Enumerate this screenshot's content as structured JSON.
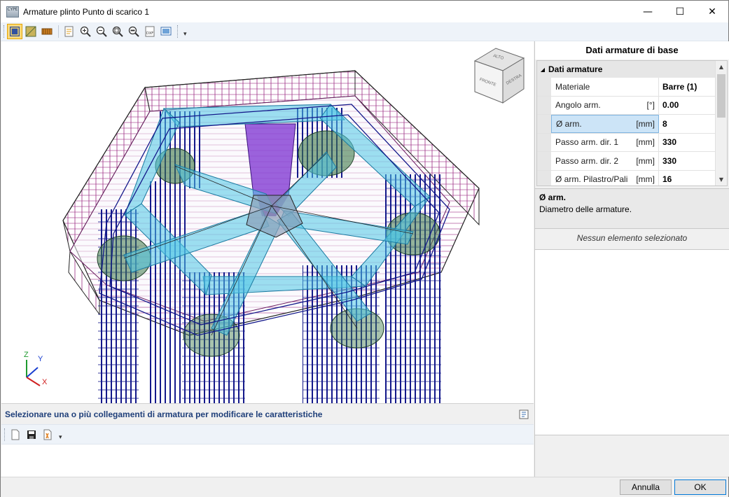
{
  "window": {
    "app_icon_text": "CYPE",
    "title": "Armature plinto Punto di scarico 1",
    "minimize": "—",
    "maximize": "☐",
    "close": "✕"
  },
  "viewport": {
    "viewcube": {
      "top": "ALTO",
      "front": "FRONTE",
      "right": "DESTRA"
    },
    "axes": {
      "x": "X",
      "y": "Y",
      "z": "Z"
    }
  },
  "hint": {
    "text": "Selezionare una o più collegamenti di armatura per modificare le caratteristiche"
  },
  "panel": {
    "title": "Dati armature di base",
    "category": "Dati armature",
    "rows": [
      {
        "name": "Materiale",
        "unit": "",
        "value": "Barre (1)",
        "dropdown": true
      },
      {
        "name": "Angolo arm.",
        "unit": "[°]",
        "value": "0.00",
        "dropdown": false
      },
      {
        "name": "Ø arm.",
        "unit": "[mm]",
        "value": "8",
        "dropdown": true
      },
      {
        "name": "Passo arm. dir. 1",
        "unit": "[mm]",
        "value": "330",
        "dropdown": false
      },
      {
        "name": "Passo arm. dir. 2",
        "unit": "[mm]",
        "value": "330",
        "dropdown": false
      },
      {
        "name": "Ø arm. Pilastro/Pali",
        "unit": "[mm]",
        "value": "16",
        "dropdown": true
      }
    ],
    "description": {
      "title": "Ø arm.",
      "text": "Diametro delle armature."
    },
    "selection_label": "Nessun elemento selezionato"
  },
  "footer": {
    "cancel": "Annulla",
    "ok": "OK"
  },
  "colors": {
    "accent": "#0078d7",
    "hint_text": "#1f3f7a",
    "toolbar_bg": "#eef3f9"
  }
}
